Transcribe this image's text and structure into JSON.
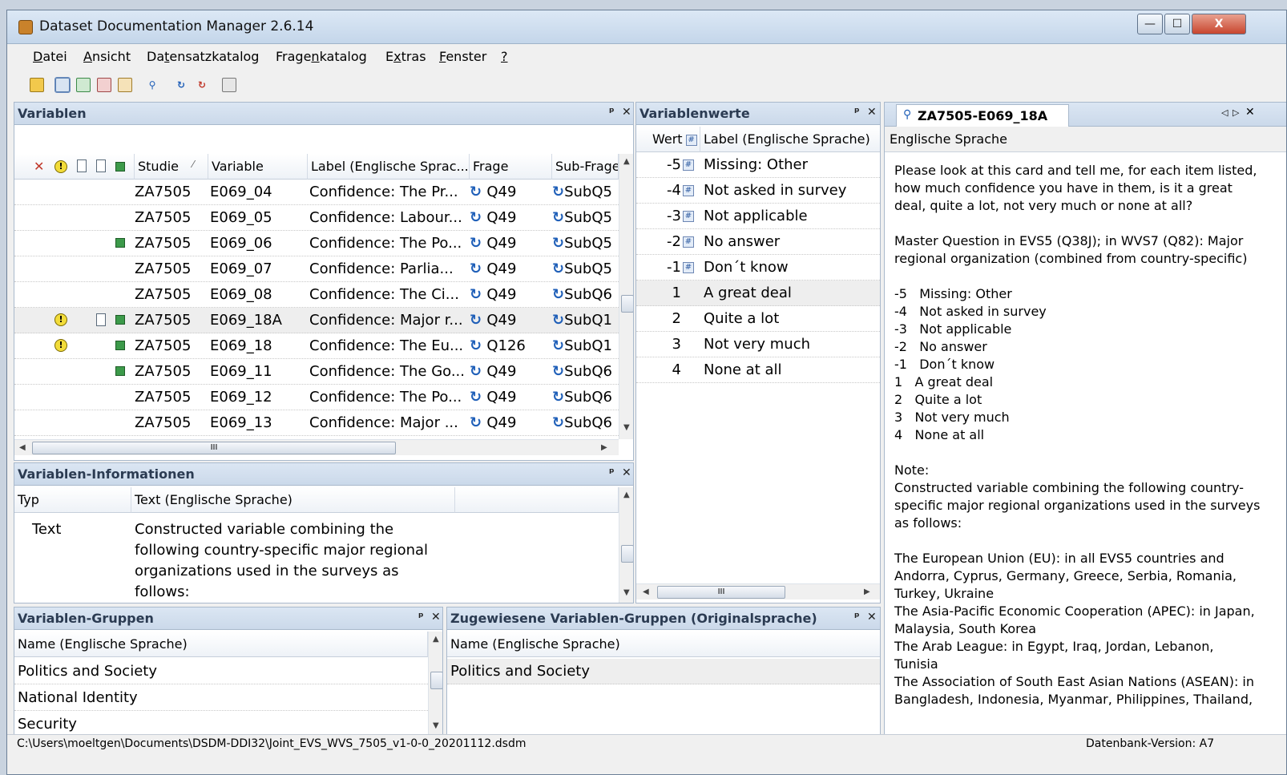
{
  "window": {
    "title": "Dataset Documentation Manager 2.6.14",
    "minimize_glyph": "—",
    "maximize_glyph": "☐",
    "close_glyph": "X"
  },
  "menu": {
    "items": [
      {
        "pre": "",
        "u": "D",
        "post": "atei"
      },
      {
        "pre": "",
        "u": "A",
        "post": "nsicht"
      },
      {
        "pre": "Da",
        "u": "t",
        "post": "ensatzkatalog"
      },
      {
        "pre": "Frage",
        "u": "n",
        "post": "katalog"
      },
      {
        "pre": "E",
        "u": "x",
        "post": "tras"
      },
      {
        "pre": "",
        "u": "F",
        "post": "enster"
      },
      {
        "pre": "",
        "u": "?",
        "post": ""
      }
    ]
  },
  "variables_panel": {
    "title": "Variablen",
    "columns": [
      "Studie",
      "Variable",
      "Label (Englische Sprac...",
      "Frage",
      "Sub-Frage"
    ],
    "sort_glyph": "⁄",
    "rows": [
      {
        "studie": "ZA7505",
        "variable": "E069_04",
        "label": "Confidence: The Pr...",
        "frage": "Q49",
        "subfrage": "SubQ5",
        "warn": false,
        "doc": false,
        "group": false,
        "selected": false
      },
      {
        "studie": "ZA7505",
        "variable": "E069_05",
        "label": "Confidence: Labour...",
        "frage": "Q49",
        "subfrage": "SubQ5",
        "warn": false,
        "doc": false,
        "group": false,
        "selected": false
      },
      {
        "studie": "ZA7505",
        "variable": "E069_06",
        "label": "Confidence: The Po...",
        "frage": "Q49",
        "subfrage": "SubQ5",
        "warn": false,
        "doc": false,
        "group": true,
        "selected": false
      },
      {
        "studie": "ZA7505",
        "variable": "E069_07",
        "label": "Confidence: Parlia...",
        "frage": "Q49",
        "subfrage": "SubQ5",
        "warn": false,
        "doc": false,
        "group": false,
        "selected": false
      },
      {
        "studie": "ZA7505",
        "variable": "E069_08",
        "label": "Confidence: The Ci...",
        "frage": "Q49",
        "subfrage": "SubQ6",
        "warn": false,
        "doc": false,
        "group": false,
        "selected": false
      },
      {
        "studie": "ZA7505",
        "variable": "E069_18A",
        "label": "Confidence: Major r...",
        "frage": "Q49",
        "subfrage": "SubQ1",
        "warn": true,
        "doc": true,
        "group": true,
        "selected": true
      },
      {
        "studie": "ZA7505",
        "variable": "E069_18",
        "label": "Confidence: The Eu...",
        "frage": "Q126",
        "subfrage": "SubQ1",
        "warn": true,
        "doc": false,
        "group": true,
        "selected": false
      },
      {
        "studie": "ZA7505",
        "variable": "E069_11",
        "label": "Confidence: The Go...",
        "frage": "Q49",
        "subfrage": "SubQ6",
        "warn": false,
        "doc": false,
        "group": true,
        "selected": false
      },
      {
        "studie": "ZA7505",
        "variable": "E069_12",
        "label": "Confidence: The Po...",
        "frage": "Q49",
        "subfrage": "SubQ6",
        "warn": false,
        "doc": false,
        "group": false,
        "selected": false
      },
      {
        "studie": "ZA7505",
        "variable": "E069_13",
        "label": "Confidence: Major ...",
        "frage": "Q49",
        "subfrage": "SubQ6",
        "warn": false,
        "doc": false,
        "group": false,
        "selected": false
      }
    ],
    "hscroll_mark": "III"
  },
  "values_panel": {
    "title": "Variablenwerte",
    "col_wert": "Wert",
    "col_label": "Label (Englische Sprache)",
    "rows": [
      {
        "wert": "-5",
        "label": "Missing: Other",
        "missing": true
      },
      {
        "wert": "-4",
        "label": "Not asked in survey",
        "missing": true
      },
      {
        "wert": "-3",
        "label": "Not applicable",
        "missing": true
      },
      {
        "wert": "-2",
        "label": "No answer",
        "missing": true
      },
      {
        "wert": "-1",
        "label": "Don´t know",
        "missing": true
      },
      {
        "wert": "1",
        "label": "A great deal",
        "missing": false
      },
      {
        "wert": "2",
        "label": "Quite a lot",
        "missing": false
      },
      {
        "wert": "3",
        "label": "Not very much",
        "missing": false
      },
      {
        "wert": "4",
        "label": "None at all",
        "missing": false
      }
    ],
    "hscroll_mark": "III"
  },
  "doc_panel": {
    "tab_title": "ZA7505-E069_18A",
    "language": "Englische Sprache",
    "text": "Please look at this card and tell me, for each item listed, how much confidence you have in them, is it a great deal, quite a lot, not very much or none at all?\n\nMaster Question in EVS5 (Q38J); in WVS7 (Q82): Major regional organization (combined from country-specific)\n\n-5   Missing: Other\n-4   Not asked in survey\n-3   Not applicable\n-2   No answer\n-1   Don´t know\n1   A great deal\n2   Quite a lot\n3   Not very much\n4   None at all\n\nNote:\nConstructed variable combining the following country-specific major regional organizations used in the surveys as follows:\n\nThe European Union (EU): in all EVS5 countries and Andorra, Cyprus, Germany, Greece, Serbia, Romania, Turkey, Ukraine\nThe Asia-Pacific Economic Cooperation (APEC): in Japan, Malaysia, South Korea\nThe Arab League: in Egypt, Iraq, Jordan, Lebanon, Tunisia\nThe Association of South East Asian Nations (ASEAN): in Bangladesh, Indonesia, Myanmar, Philippines, Thailand,"
  },
  "info_panel": {
    "title": "Variablen-Informationen",
    "col_typ": "Typ",
    "col_text": "Text (Englische Sprache)",
    "row_typ": "Text",
    "row_text": "Constructed variable combining the following country-specific major regional organizations used in the surveys as follows:"
  },
  "groups_panel": {
    "title": "Variablen-Gruppen",
    "col_name": "Name (Englische Sprache)",
    "items": [
      "Politics and Society",
      "National Identity",
      "Security"
    ]
  },
  "assigned_groups_panel": {
    "title": "Zugewiesene Variablen-Gruppen (Originalsprache)",
    "col_name": "Name (Englische Sprache)",
    "items": [
      "Politics and Society"
    ]
  },
  "statusbar": {
    "path": "C:\\Users\\moeltgen\\Documents\\DSDM-DDI32\\Joint_EVS_WVS_7505_v1-0-0_20201112.dsdm",
    "db_version": "Datenbank-Version: A7"
  },
  "colors": {
    "accent_header": "#dbe6f3",
    "question_icon": "#1f5fb8",
    "group_icon": "#3c9a4a",
    "warning_icon": "#f2dc3a"
  }
}
